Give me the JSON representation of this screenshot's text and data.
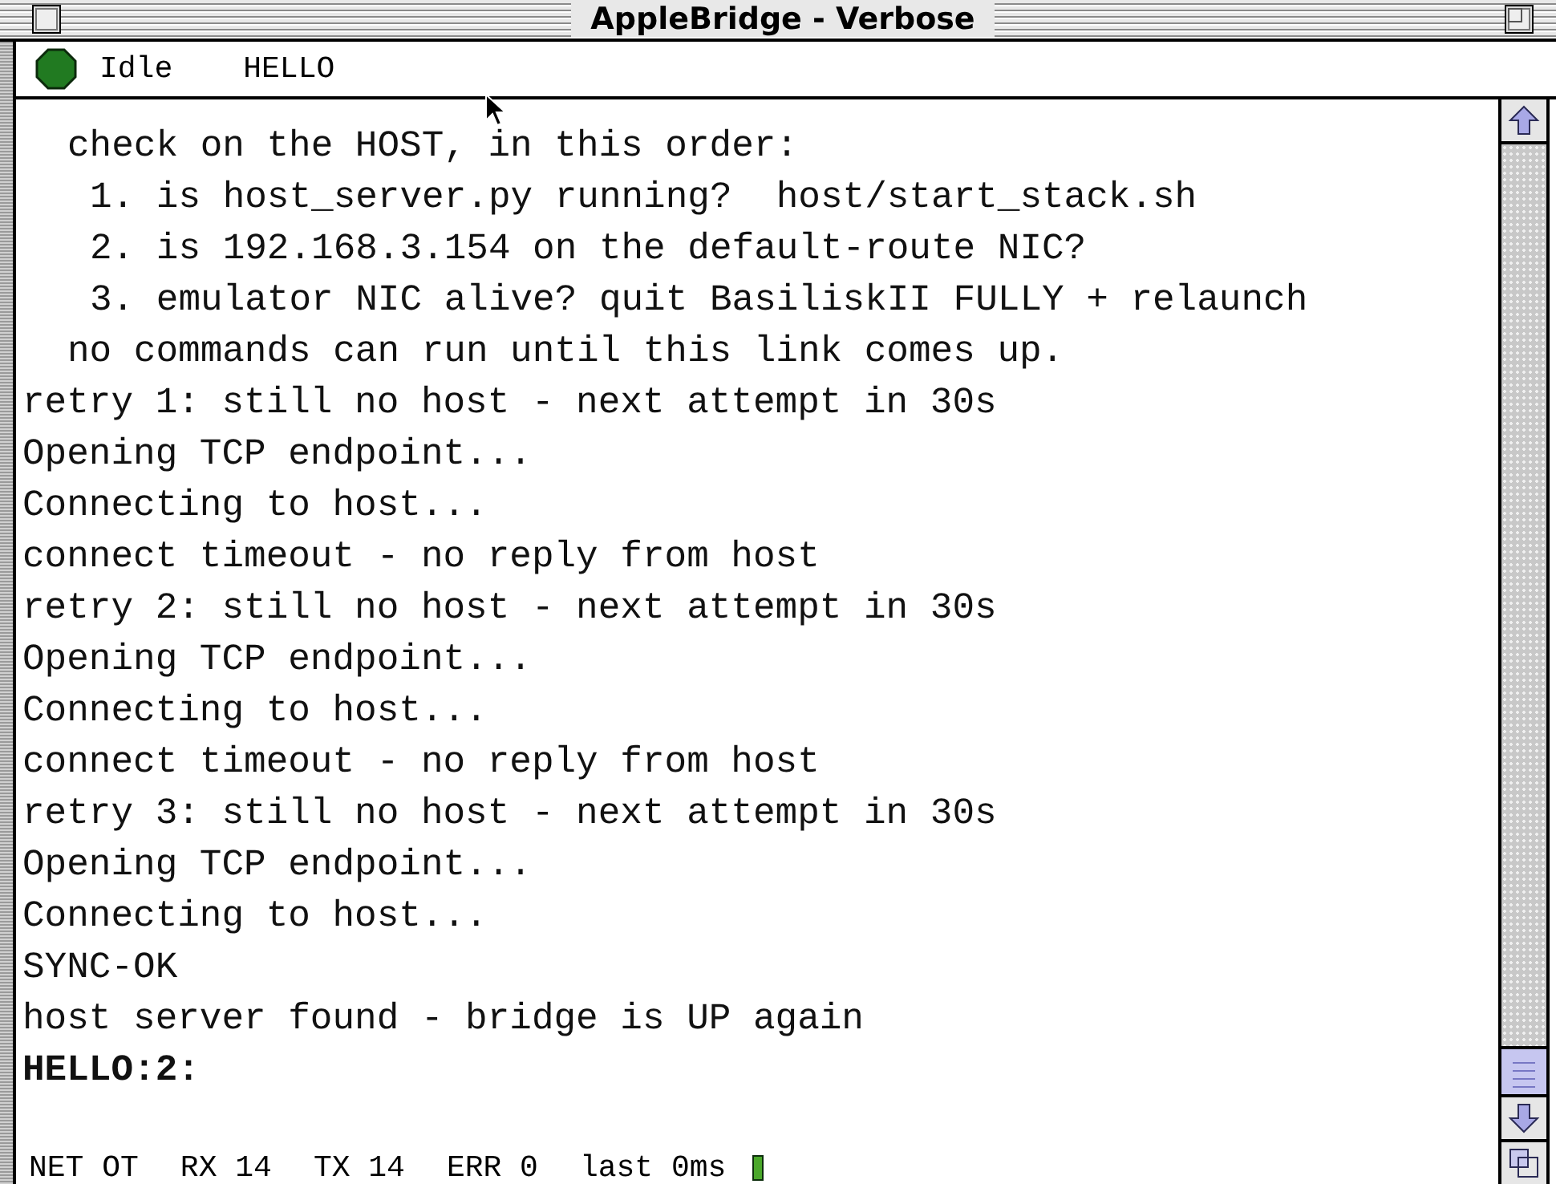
{
  "window": {
    "title": "AppleBridge - Verbose"
  },
  "status": {
    "state": "Idle",
    "command": "HELLO"
  },
  "log": {
    "lines": [
      {
        "kind": "detail",
        "text": "check on the HOST, in this order:"
      },
      {
        "kind": "step",
        "text": "1. is host_server.py running?  host/start_stack.sh"
      },
      {
        "kind": "step",
        "text": "2. is 192.168.3.154 on the default-route NIC?"
      },
      {
        "kind": "step",
        "text": "3. emulator NIC alive? quit BasiliskII FULLY + relaunch"
      },
      {
        "kind": "detail",
        "text": "no commands can run until this link comes up."
      },
      {
        "kind": "output",
        "text": "retry 1: still no host - next attempt in 30s"
      },
      {
        "kind": "output",
        "text": "Opening TCP endpoint..."
      },
      {
        "kind": "output",
        "text": "Connecting to host..."
      },
      {
        "kind": "output",
        "text": "connect timeout - no reply from host"
      },
      {
        "kind": "output",
        "text": "retry 2: still no host - next attempt in 30s"
      },
      {
        "kind": "output",
        "text": "Opening TCP endpoint..."
      },
      {
        "kind": "output",
        "text": "Connecting to host..."
      },
      {
        "kind": "output",
        "text": "connect timeout - no reply from host"
      },
      {
        "kind": "output",
        "text": "retry 3: still no host - next attempt in 30s"
      },
      {
        "kind": "output",
        "text": "Opening TCP endpoint..."
      },
      {
        "kind": "output",
        "text": "Connecting to host..."
      },
      {
        "kind": "output",
        "text": "SYNC-OK"
      },
      {
        "kind": "output",
        "text": "host server found - bridge is UP again"
      },
      {
        "kind": "reply",
        "text": "HELLO:2:"
      }
    ]
  },
  "counters": [
    "NET OT",
    "RX 14",
    "TX 14",
    "ERR 0",
    "last 0ms"
  ]
}
